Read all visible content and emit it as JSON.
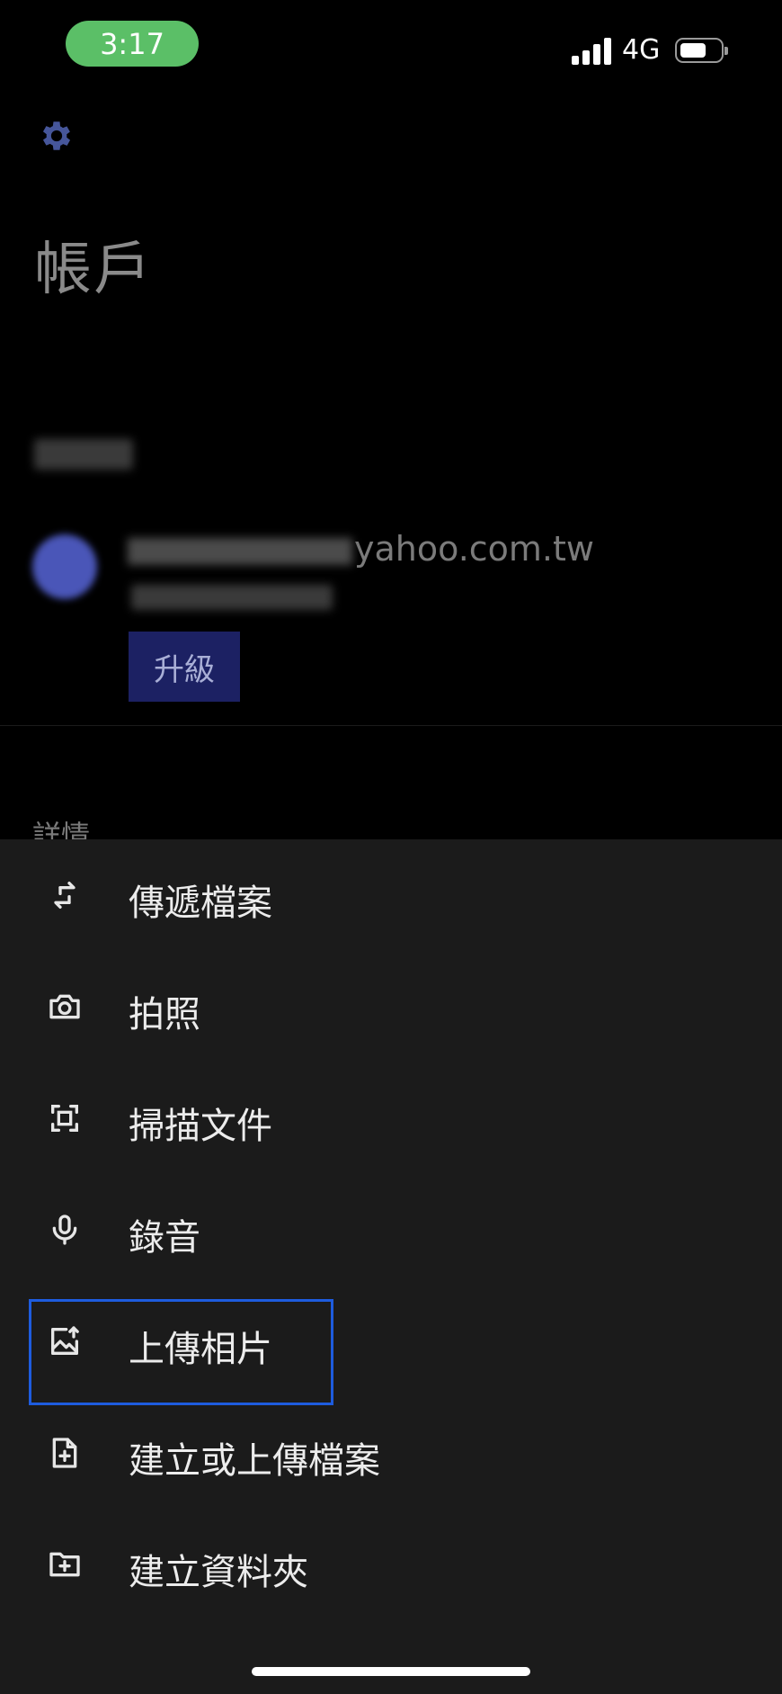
{
  "status_bar": {
    "time": "3:17",
    "network": "4G",
    "battery_level": 0.6
  },
  "background_page": {
    "title": "帳戶",
    "email_suffix": "yahoo.com.tw",
    "upgrade_label": "升級",
    "details_label": "詳情",
    "accent_color": "#1c2163"
  },
  "action_sheet": {
    "items": [
      {
        "label": "傳遞檔案",
        "icon": "transfer-arrows-icon"
      },
      {
        "label": "拍照",
        "icon": "camera-icon"
      },
      {
        "label": "掃描文件",
        "icon": "scan-document-icon"
      },
      {
        "label": "錄音",
        "icon": "microphone-icon"
      },
      {
        "label": "上傳相片",
        "icon": "upload-photo-icon"
      },
      {
        "label": "建立或上傳檔案",
        "icon": "add-file-icon"
      },
      {
        "label": "建立資料夾",
        "icon": "add-folder-icon"
      }
    ],
    "highlight_color": "#1e5cde"
  }
}
